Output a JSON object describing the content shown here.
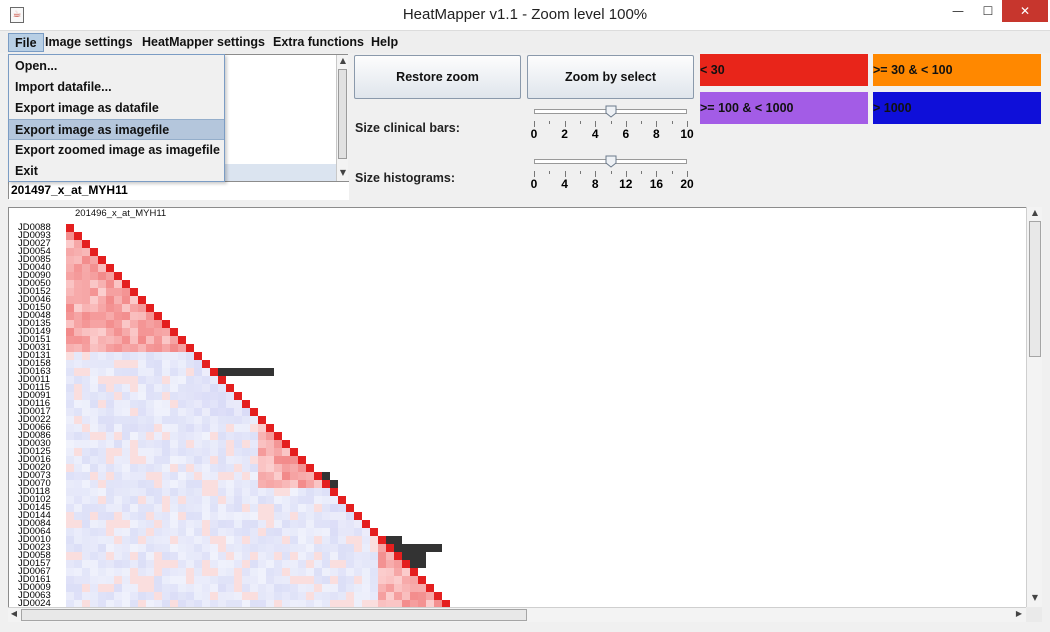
{
  "window": {
    "title": "HeatMapper v1.1 - Zoom level 100%"
  },
  "menubar": {
    "items": [
      "File",
      "Image settings",
      "HeatMapper settings",
      "Extra functions",
      "Help"
    ]
  },
  "file_menu": {
    "items": [
      "Open...",
      "Import datafile...",
      "Export image as datafile",
      "Export image as imagefile",
      "Export zoomed image as imagefile",
      "Exit"
    ],
    "highlighted_index": 3
  },
  "gene_field": {
    "value": "201497_x_at_MYH11"
  },
  "buttons": {
    "restore_zoom": "Restore zoom",
    "zoom_by_select": "Zoom by select"
  },
  "sliders": [
    {
      "label": "Size clinical bars:",
      "min": 0,
      "max": 10,
      "value": 5,
      "tick_labels": [
        "0",
        "2",
        "4",
        "6",
        "8",
        "10"
      ]
    },
    {
      "label": "Size histograms:",
      "min": 0,
      "max": 20,
      "value": 10,
      "tick_labels": [
        "0",
        "4",
        "8",
        "12",
        "16",
        "20"
      ]
    }
  ],
  "legend": [
    {
      "label": "< 30",
      "color": "#e8251a"
    },
    {
      "label": ">= 30 & < 100",
      "color": "#ff8800"
    },
    {
      "label": ">= 100 & < 1000",
      "color": "#a35ce6"
    },
    {
      "label": "> 1000",
      "color": "#0f0fd9"
    }
  ],
  "heatmap": {
    "label": "201496_x_at_MYH11",
    "samples": [
      "JD0088",
      "JD0093",
      "JD0027",
      "JD0054",
      "JD0085",
      "JD0040",
      "JD0090",
      "JD0050",
      "JD0152",
      "JD0046",
      "JD0150",
      "JD0048",
      "JD0135",
      "JD0149",
      "JD0151",
      "JD0031",
      "JD0131",
      "JD0158",
      "JD0163",
      "JD0011",
      "JD0115",
      "JD0091",
      "JD0116",
      "JD0017",
      "JD0022",
      "JD0066",
      "JD0086",
      "JD0030",
      "JD0125",
      "JD0016",
      "JD0020",
      "JD0073",
      "JD0070",
      "JD0118",
      "JD0102",
      "JD0145",
      "JD0144",
      "JD0084",
      "JD0064",
      "JD0010",
      "JD0023",
      "JD0058",
      "JD0157",
      "JD0067",
      "JD0161",
      "JD0009",
      "JD0063",
      "JD0024"
    ],
    "clusters": [
      {
        "start": 0,
        "end": 16,
        "tone": "red"
      },
      {
        "start": 16,
        "end": 24,
        "tone": "blue"
      },
      {
        "start": 24,
        "end": 33,
        "tone": "red"
      },
      {
        "start": 33,
        "end": 39,
        "tone": "blue"
      },
      {
        "start": 39,
        "end": 48,
        "tone": "red"
      }
    ],
    "histogram": [
      {
        "row": 18,
        "value": 7
      },
      {
        "row": 31,
        "value": 1
      },
      {
        "row": 32,
        "value": 1
      },
      {
        "row": 39,
        "value": 2
      },
      {
        "row": 40,
        "value": 6
      },
      {
        "row": 41,
        "value": 3
      },
      {
        "row": 42,
        "value": 2
      }
    ],
    "colors": {
      "diagonal": "#e41f1f",
      "histogram": "#333333",
      "red_base": "#f3a3a3",
      "blue_base": "#dadcf5"
    }
  }
}
